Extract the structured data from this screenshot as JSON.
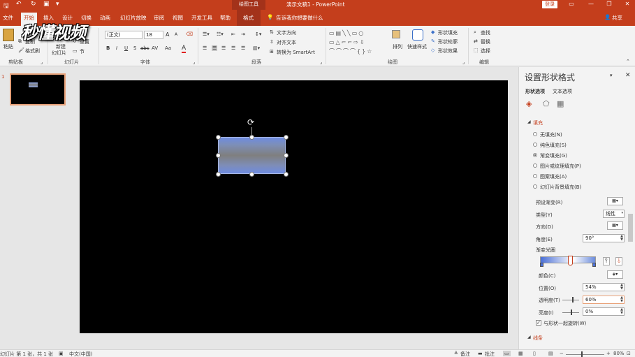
{
  "titlebar": {
    "context_tools": "绘图工具",
    "document_title": "演示文稿1 - PowerPoint",
    "login": "登录"
  },
  "tabs": [
    "文件",
    "开始",
    "插入",
    "设计",
    "切换",
    "动画",
    "幻灯片放映",
    "审阅",
    "视图",
    "开发工具",
    "帮助",
    "格式"
  ],
  "tell_me": "告诉我你想要做什么",
  "share": "共享",
  "logo_text": "秒懂视频",
  "ribbon": {
    "clipboard": {
      "paste": "粘贴",
      "copy": "复制",
      "format_painter": "格式刷",
      "group": "剪贴板"
    },
    "slides": {
      "new_slide_1": "新建",
      "new_slide_2": "幻灯片",
      "reset": "重置",
      "section": "节",
      "group": "幻灯片"
    },
    "font": {
      "font_name": "(正文)",
      "font_size": "18",
      "bold": "B",
      "italic": "I",
      "underline": "U",
      "shadow": "S",
      "strike": "abc",
      "spacing": "AV",
      "case": "Aa",
      "color": "A",
      "grow": "A",
      "shrink": "A",
      "group": "字体"
    },
    "paragraph": {
      "text_direction": "文字方向",
      "align_text": "对齐文本",
      "smartart": "转换为 SmartArt",
      "group": "段落"
    },
    "drawing": {
      "arrange": "排列",
      "quick_styles": "快速样式",
      "shape_fill": "形状填充",
      "shape_outline": "形状轮廓",
      "shape_effects": "形状效果",
      "group": "绘图"
    },
    "editing": {
      "find": "查找",
      "replace": "替换",
      "select": "选择",
      "group": "编辑"
    }
  },
  "thumbs": {
    "slide_number": "1"
  },
  "pane": {
    "title": "设置形状格式",
    "tab_shape": "形状选项",
    "tab_text": "文本选项",
    "section_fill": "填充",
    "fill_options": [
      "无填充(N)",
      "纯色填充(S)",
      "渐变填充(G)",
      "图片或纹理填充(P)",
      "图案填充(A)",
      "幻灯片背景填充(B)"
    ],
    "fill_selected_index": 2,
    "preset_label": "预设渐变(R)",
    "type_label": "类型(Y)",
    "type_value": "线性",
    "direction_label": "方向(D)",
    "angle_label": "角度(E)",
    "angle_value": "90°",
    "stops_label": "渐变光圈",
    "color_label": "颜色(C)",
    "position_label": "位置(O)",
    "position_value": "54%",
    "transparency_label": "透明度(T)",
    "transparency_value": "60%",
    "brightness_label": "亮度(I)",
    "brightness_value": "0%",
    "rotate_with_shape": "与形状一起旋转(W)",
    "section_line": "线条"
  },
  "status": {
    "slide_info": "幻灯片 第 1 张，共 1 张",
    "language": "中文(中国)",
    "notes": "备注",
    "comments": "批注",
    "zoom": "80%"
  }
}
